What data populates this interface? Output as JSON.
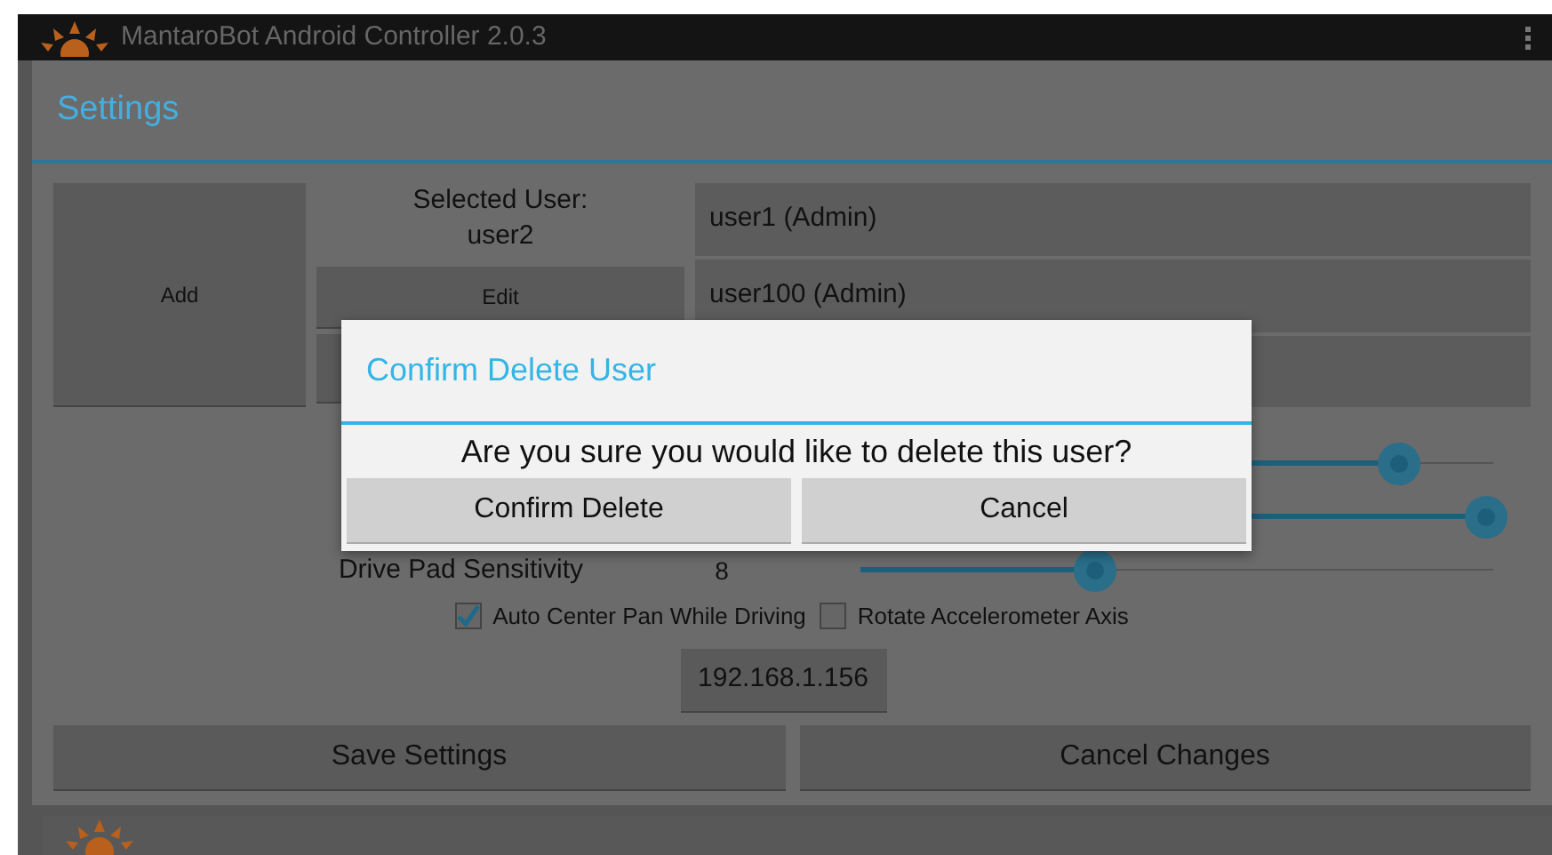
{
  "app_bar": {
    "title": "MantaroBot Android Controller 2.0.3"
  },
  "settings": {
    "title": "Settings",
    "add_button": "Add",
    "selected_user_label": "Selected User:",
    "selected_user": "user2",
    "edit_button": "Edit",
    "users": [
      {
        "name": "user1 (Admin)"
      },
      {
        "name": "user100 (Admin)"
      }
    ],
    "sliders": [
      {
        "level": 0.85
      },
      {
        "level": 0.99
      },
      {
        "label": "Drive Pad Sensitivity",
        "value": "8",
        "level": 0.37
      }
    ],
    "checkboxes": [
      {
        "label": "Auto Center Pan While Driving",
        "checked": true
      },
      {
        "label": "Rotate Accelerometer Axis",
        "checked": false
      }
    ],
    "ip_button": "192.168.1.156",
    "buttons": [
      "Save Settings",
      "Cancel Changes"
    ]
  },
  "dialog": {
    "title": "Confirm Delete User",
    "message": "Are you sure you would like to delete this user?",
    "buttons": [
      "Confirm Delete",
      "Cancel"
    ]
  }
}
